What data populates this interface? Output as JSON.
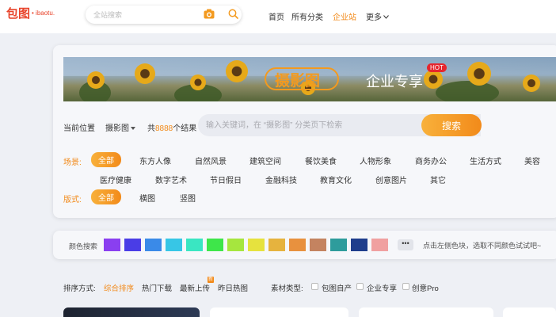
{
  "header": {
    "logo_mark": "包图",
    "logo_text": "• ibaotu.",
    "search_placeholder": "全站搜索",
    "nav": [
      "首页",
      "所有分类",
      "企业站",
      "更多"
    ],
    "active_nav": "企业站"
  },
  "banner": {
    "title_left": "摄影图",
    "title_right": "企业专享",
    "hot": "HOT"
  },
  "location": {
    "label": "当前位置",
    "category": "摄影图",
    "count_prefix": "共",
    "count": "8888",
    "count_suffix": "个结果",
    "keyword_placeholder": "输入关键词，在 “摄影图” 分类页下检索",
    "search_button": "搜索"
  },
  "filters": {
    "scene_label": "场景:",
    "scene_row1": [
      "全部",
      "东方人像",
      "自然风景",
      "建筑空间",
      "餐饮美食",
      "人物形象",
      "商务办公",
      "生活方式",
      "美容"
    ],
    "scene_row2": [
      "医疗健康",
      "数字艺术",
      "节日假日",
      "金融科技",
      "教育文化",
      "创意图片",
      "其它"
    ],
    "format_label": "版式:",
    "formats": [
      "全部",
      "横图",
      "竖图"
    ]
  },
  "colors": {
    "label": "颜色搜索",
    "swatches": [
      "#8a3ff0",
      "#4a3de6",
      "#3a8ae8",
      "#37c6e6",
      "#3ae6c2",
      "#3ee64a",
      "#a6e63e",
      "#e6e23e",
      "#e6b33e",
      "#e8913e",
      "#c48360",
      "#2e9c9c",
      "#1e3d8c",
      "#f0a0a0"
    ],
    "more": "•••",
    "hint": "点击左侧色块，选取不同颜色试试吧~"
  },
  "sort": {
    "label": "排序方式:",
    "options": [
      "综合排序",
      "热门下载",
      "最新上传",
      "昨日热图"
    ],
    "new_badge": "新",
    "material_label": "素材类型:",
    "materials": [
      "包图自产",
      "企业专享",
      "创意Pro"
    ]
  }
}
